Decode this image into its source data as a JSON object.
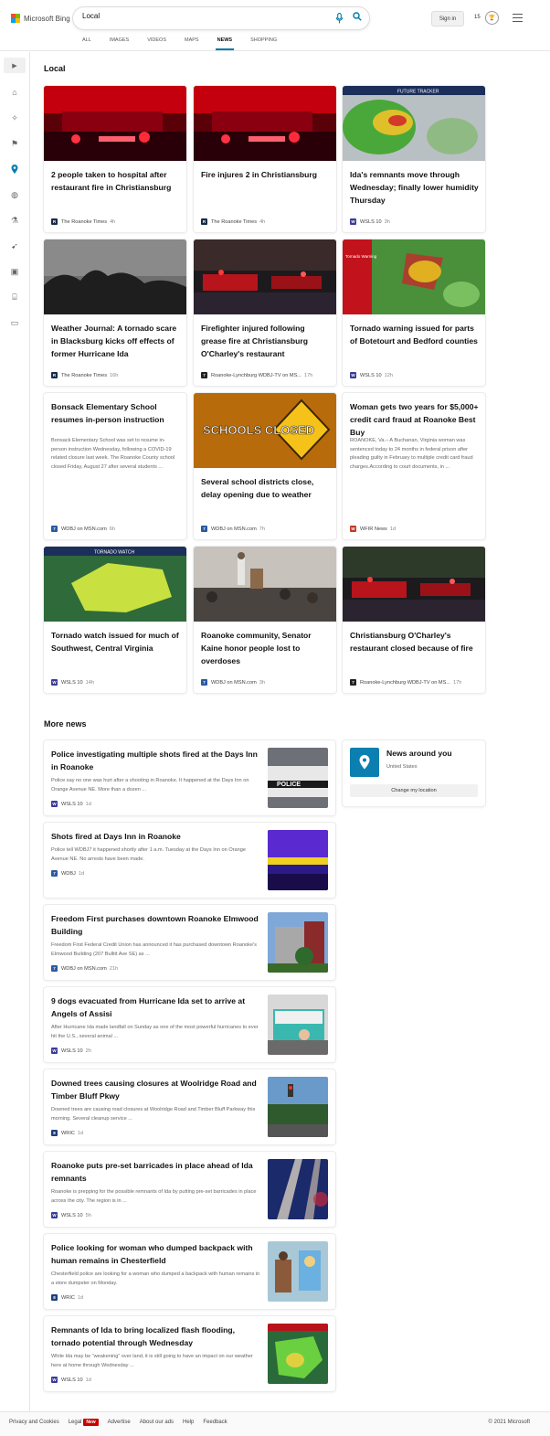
{
  "header": {
    "logo_text": "Microsoft Bing",
    "search_value": "Local",
    "signin_label": "Sign in",
    "rewards_count": "15",
    "tabs": [
      {
        "label": "ALL"
      },
      {
        "label": "IMAGES"
      },
      {
        "label": "VIDEOS"
      },
      {
        "label": "MAPS"
      },
      {
        "label": "NEWS"
      },
      {
        "label": "SHOPPING"
      }
    ],
    "active_tab": "NEWS"
  },
  "sidebar": {
    "icons": [
      "chevron-right-icon",
      "home-icon",
      "satellite-icon",
      "flag-icon",
      "location-pin-icon",
      "globe-icon",
      "science-icon",
      "rocket-icon",
      "video-icon",
      "bank-icon",
      "card-icon"
    ],
    "active": "location-pin-icon"
  },
  "local": {
    "title": "Local",
    "cards": [
      {
        "title": "2 people taken to hospital after restaurant fire in Christiansburg",
        "source": "The Roanoke Times",
        "time": "4h",
        "logo": "R",
        "logo_color": "#1a2a4a"
      },
      {
        "title": "Fire injures 2 in Christiansburg",
        "source": "The Roanoke Times",
        "time": "4h",
        "logo": "R",
        "logo_color": "#1a2a4a"
      },
      {
        "title": "Ida's remnants move through Wednesday; finally lower humidity Thursday",
        "source": "WSLS 10",
        "time": "3h",
        "logo": "W",
        "logo_color": "#3b3b9a",
        "img_text": "FUTURE TRACKER"
      },
      {
        "title": "Weather Journal: A tornado scare in Blacksburg kicks off effects of former Hurricane Ida",
        "source": "The Roanoke Times",
        "time": "16h",
        "logo": "R",
        "logo_color": "#1a2a4a"
      },
      {
        "title": "Firefighter injured following grease fire at Christiansburg O'Charley's restaurant",
        "source": "Roanoke-Lynchburg WDBJ-TV on MS...",
        "time": "17h",
        "logo": "7",
        "logo_color": "#222222"
      },
      {
        "title": "Tornado warning issued for parts of Botetourt and Bedford counties",
        "source": "WSLS 10",
        "time": "12h",
        "logo": "W",
        "logo_color": "#3b3b9a",
        "img_text": "Tornado Warning"
      },
      {
        "title": "Bonsack Elementary School resumes in-person instruction",
        "snippet": "Bonsack Elementary School was set to resume in-person instruction Wednesday, following a COVID-19 related closure last week. The Roanoke County school closed Friday, August 27 after several students ...",
        "source": "WDBJ on MSN.com",
        "time": "6h",
        "logo": "7",
        "logo_color": "#2a5aa0"
      },
      {
        "title": "Several school districts close, delay opening due to weather",
        "source": "WDBJ on MSN.com",
        "time": "7h",
        "logo": "7",
        "logo_color": "#2a5aa0",
        "img_text": "SCHOOLS CLOSED"
      },
      {
        "title": "Woman gets two years for $5,000+ credit card fraud at Roanoke Best Buy",
        "snippet": "ROANOKE, Va.– A Buchanan, Virginia woman was sentenced today to 24 months in federal prison after pleading guilty in February to multiple credit card fraud charges.According to court documents, in ...",
        "source": "WFIR News",
        "time": "1d",
        "logo": "W",
        "logo_color": "#c0392b"
      },
      {
        "title": "Tornado watch issued for much of Southwest, Central Virginia",
        "source": "WSLS 10",
        "time": "14h",
        "logo": "W",
        "logo_color": "#3b3b9a",
        "img_text": "TORNADO WATCH"
      },
      {
        "title": "Roanoke community, Senator Kaine honor people lost to overdoses",
        "source": "WDBJ on MSN.com",
        "time": "3h",
        "logo": "7",
        "logo_color": "#2a5aa0"
      },
      {
        "title": "Christiansburg O'Charley's restaurant closed because of fire",
        "source": "Roanoke-Lynchburg WDBJ-TV on MS...",
        "time": "17h",
        "logo": "7",
        "logo_color": "#222222"
      }
    ]
  },
  "more_news": {
    "title": "More news",
    "items": [
      {
        "title": "Police investigating multiple shots fired at the Days Inn in Roanoke",
        "snippet": "Police say no one was hurt after a shooting in Roanoke. It happened at the Days Inn on Orange Avenue NE. More than a dozen ...",
        "source": "WSLS 10",
        "time": "1d",
        "logo": "W",
        "logo_color": "#3b3b9a"
      },
      {
        "title": "Shots fired at Days Inn in Roanoke",
        "snippet": "Police tell WDBJ7 it happened shortly after 1 a.m. Tuesday at the Days Inn on Orange Avenue NE. No arrests have been made.",
        "source": "WDBJ",
        "time": "1d",
        "logo": "7",
        "logo_color": "#2a5aa0"
      },
      {
        "title": "Freedom First purchases downtown Roanoke Elmwood Building",
        "snippet": "Freedom First Federal Credit Union has announced it has purchased downtown Roanoke's Elmwood Building (207 Bullitt Ave SE) as ...",
        "source": "WDBJ on MSN.com",
        "time": "21h",
        "logo": "7",
        "logo_color": "#2a5aa0"
      },
      {
        "title": "9 dogs evacuated from Hurricane Ida set to arrive at Angels of Assisi",
        "snippet": "After Hurricane Ida made landfall on Sunday as one of the most powerful hurricanes to ever hit the U.S., several animal ...",
        "source": "WSLS 10",
        "time": "2h",
        "logo": "W",
        "logo_color": "#3b3b9a"
      },
      {
        "title": "Downed trees causing closures at Woolridge Road and Timber Bluff Pkwy",
        "snippet": "Downed trees are causing road closures at Woolridge Road and Timber Bluff Parkway this morning. Several cleanup service ...",
        "source": "WRIC",
        "time": "1d",
        "logo": "8",
        "logo_color": "#1f3f7a"
      },
      {
        "title": "Roanoke puts pre-set barricades in place ahead of Ida remnants",
        "snippet": "Roanoke is prepping for the possible remnants of Ida by putting pre-set barricades in place across the city. The region is in ...",
        "source": "WSLS 10",
        "time": "5h",
        "logo": "W",
        "logo_color": "#3b3b9a"
      },
      {
        "title": "Police looking for woman who dumped backpack with human remains in Chesterfield",
        "snippet": "Chesterfield police are looking for a woman who dumped a backpack with human remains in a store dumpster on Monday.",
        "source": "WRIC",
        "time": "1d",
        "logo": "8",
        "logo_color": "#1f3f7a"
      },
      {
        "title": "Remnants of Ida to bring localized flash flooding, tornado potential through Wednesday",
        "snippet": "While Ida may be “weakening” over land, it is still going to have an impact on our weather here at home through Wednesday ...",
        "source": "WSLS 10",
        "time": "1d",
        "logo": "W",
        "logo_color": "#3b3b9a"
      }
    ]
  },
  "around_you": {
    "title": "News around you",
    "subtitle": "United States",
    "button": "Change my location"
  },
  "footer": {
    "links": [
      "Privacy and Cookies",
      "Legal",
      "Advertise",
      "About our ads",
      "Help",
      "Feedback"
    ],
    "new_badge": "New",
    "copyright": "© 2021 Microsoft"
  },
  "colors": {
    "accent": "#0078a8",
    "badge": "#c80000"
  }
}
